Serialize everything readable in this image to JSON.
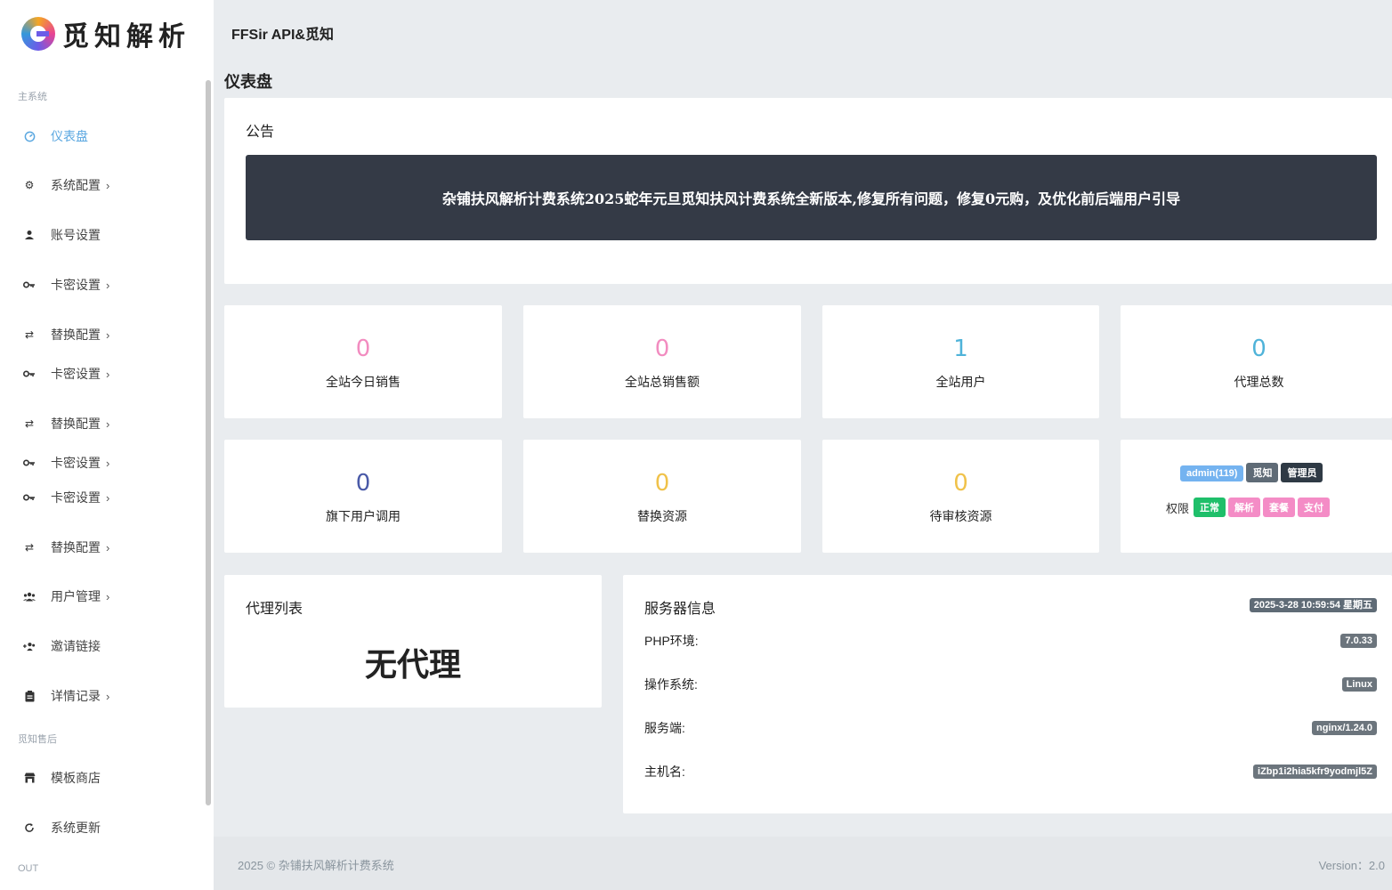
{
  "brand": {
    "name": "觅知解析"
  },
  "header": {
    "title": "FFSir API&觅知"
  },
  "page_title": "仪表盘",
  "sidebar": {
    "section_main": "主系统",
    "section_after": "觅知售后",
    "section_out": "OUT",
    "items": [
      {
        "label": "仪表盘",
        "icon": "dashboard-icon",
        "chevron": ""
      },
      {
        "label": "系统配置",
        "icon": "gear-icon",
        "chevron": "›"
      },
      {
        "label": "账号设置",
        "icon": "user-icon",
        "chevron": ""
      },
      {
        "label": "卡密设置",
        "icon": "key-icon",
        "chevron": "›"
      },
      {
        "label": "替换配置",
        "icon": "swap-icon",
        "chevron": "›"
      },
      {
        "label": "卡密设置",
        "icon": "key-icon",
        "chevron": "›"
      },
      {
        "label": "替换配置",
        "icon": "swap-icon",
        "chevron": "›"
      },
      {
        "label": "卡密设置",
        "icon": "key-icon",
        "chevron": "›"
      },
      {
        "label": "卡密设置",
        "icon": "key-icon",
        "chevron": "›"
      },
      {
        "label": "替换配置",
        "icon": "swap-icon",
        "chevron": "›"
      },
      {
        "label": "用户管理",
        "icon": "users-icon",
        "chevron": "›"
      },
      {
        "label": "邀请链接",
        "icon": "user-plus-icon",
        "chevron": ""
      },
      {
        "label": "详情记录",
        "icon": "clipboard-icon",
        "chevron": "›"
      },
      {
        "label": "模板商店",
        "icon": "store-icon",
        "chevron": ""
      },
      {
        "label": "系统更新",
        "icon": "refresh-icon",
        "chevron": ""
      }
    ]
  },
  "notice": {
    "title": "公告",
    "text": "杂铺扶风解析计费系统2025蛇年元旦觅知扶风计费系统全新版本,修复所有问题，修复0元购，及优化前后端用户引导"
  },
  "stats": [
    {
      "value": "0",
      "label": "全站今日销售",
      "color": "#f28cc0"
    },
    {
      "value": "0",
      "label": "全站总销售额",
      "color": "#f28cc0"
    },
    {
      "value": "1",
      "label": "全站用户",
      "color": "#4fb3d9"
    },
    {
      "value": "0",
      "label": "代理总数",
      "color": "#4fb3d9"
    },
    {
      "value": "0",
      "label": "旗下用户调用",
      "color": "#4a5aa8"
    },
    {
      "value": "0",
      "label": "替换资源",
      "color": "#f0c24a"
    },
    {
      "value": "0",
      "label": "待审核资源",
      "color": "#f0c24a"
    }
  ],
  "user_card": {
    "badges": [
      {
        "text": "admin(119)",
        "color": "#74b3f0"
      },
      {
        "text": "觅知",
        "color": "#5f6b76"
      },
      {
        "text": "管理员",
        "color": "#2f3a45"
      }
    ],
    "perm_label": "权限",
    "perms": [
      {
        "text": "正常",
        "color": "#1fbf6a"
      },
      {
        "text": "解析",
        "color": "#f48cc6"
      },
      {
        "text": "套餐",
        "color": "#f48cc6"
      },
      {
        "text": "支付",
        "color": "#f48cc6"
      }
    ]
  },
  "agents": {
    "title": "代理列表",
    "empty": "无代理"
  },
  "server": {
    "title": "服务器信息",
    "datetime": "2025-3-28 10:59:54 星期五",
    "rows": [
      {
        "key": "PHP环境:",
        "value": "7.0.33"
      },
      {
        "key": "操作系统:",
        "value": "Linux"
      },
      {
        "key": "服务端:",
        "value": "nginx/1.24.0"
      },
      {
        "key": "主机名:",
        "value": "iZbp1i2hia5kfr9yodmjl5Z"
      }
    ]
  },
  "footer": {
    "left": "2025 © 杂铺扶风解析计费系统",
    "right": "Version：2.0"
  }
}
